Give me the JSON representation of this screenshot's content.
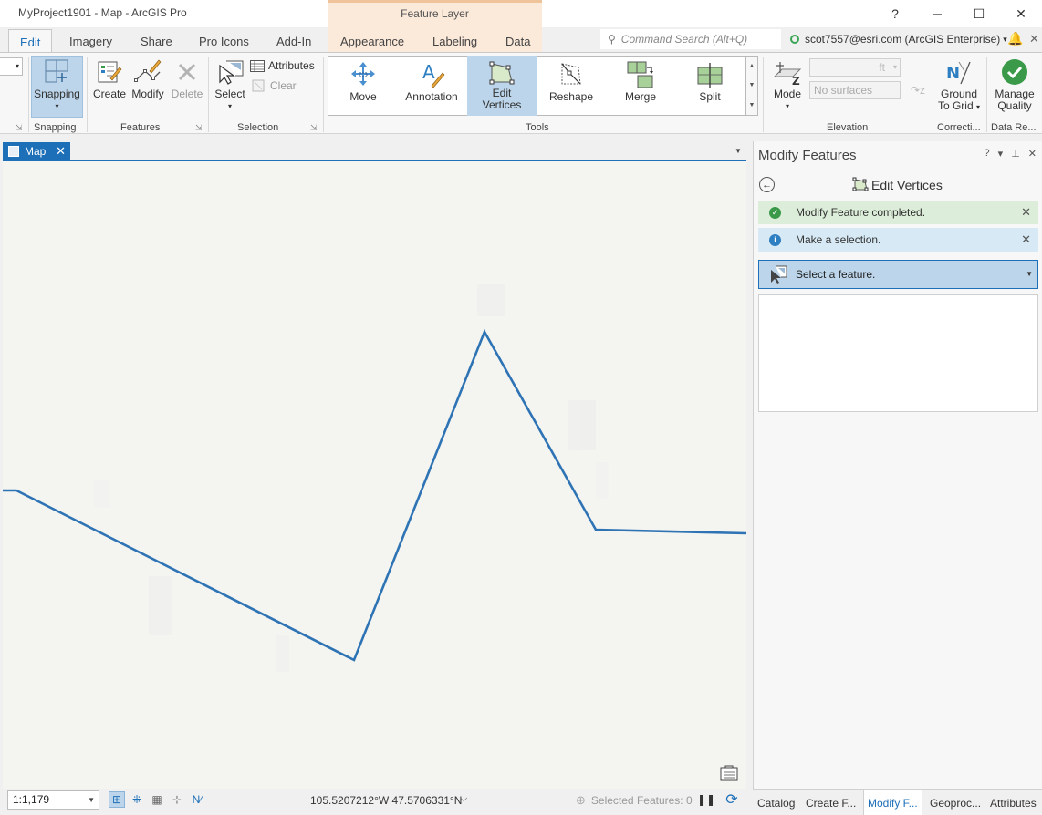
{
  "app": {
    "window_title": "MyProject1901 - Map - ArcGIS Pro",
    "context_tab_group": "Feature Layer",
    "help": "?",
    "min": "─",
    "max": "☐",
    "close": "✕"
  },
  "tabs": [
    {
      "label": "Edit"
    },
    {
      "label": "Imagery"
    },
    {
      "label": "Share"
    },
    {
      "label": "Pro Icons"
    },
    {
      "label": "Add-In"
    },
    {
      "label": "Appearance"
    },
    {
      "label": "Labeling"
    },
    {
      "label": "Data"
    }
  ],
  "command_search": {
    "placeholder": "Command Search (Alt+Q)"
  },
  "user": {
    "label": "scot7557@esri.com (ArcGIS Enterprise)",
    "arrow": "▾"
  },
  "ribbon": {
    "snapping": {
      "button": "Snapping",
      "group": "Snapping"
    },
    "features": {
      "create": "Create",
      "modify": "Modify",
      "delete": "Delete",
      "group": "Features"
    },
    "selection": {
      "select": "Select",
      "attributes": "Attributes",
      "clear": "Clear",
      "group": "Selection"
    },
    "tools": {
      "group": "Tools",
      "items": [
        {
          "label": "Move"
        },
        {
          "label": "Annotation"
        },
        {
          "label": "Edit\nVertices"
        },
        {
          "label": "Reshape"
        },
        {
          "label": "Merge"
        },
        {
          "label": "Split"
        }
      ]
    },
    "elevation": {
      "mode": "Mode",
      "unit": "ft",
      "surface": "No surfaces",
      "group": "Elevation"
    },
    "corrections": {
      "ground_to_grid_1": "Ground",
      "ground_to_grid_2": "To Grid",
      "group": "Correcti..."
    },
    "data_reviewer": {
      "manage_1": "Manage",
      "manage_2": "Quality",
      "group": "Data Re..."
    }
  },
  "map": {
    "tab_label": "Map",
    "scale": "1:1,179",
    "coordinates": "105.5207212°W 47.5706331°N",
    "selected_features": "Selected Features: 0",
    "accent": "#1d6fb8",
    "line_color": "#2e74b5"
  },
  "pane": {
    "title": "Modify Features",
    "ctrl_help": "?",
    "ctrl_menu": "▾",
    "ctrl_pin": "⊥",
    "ctrl_close": "✕",
    "tool_title": "Edit Vertices",
    "msg_ok": "Modify Feature completed.",
    "msg_info": "Make a selection.",
    "select_prompt": "Select a feature."
  },
  "bottom_tabs": [
    {
      "label": "Catalog"
    },
    {
      "label": "Create F..."
    },
    {
      "label": "Modify F..."
    },
    {
      "label": "Geoproc..."
    },
    {
      "label": "Attributes"
    }
  ]
}
